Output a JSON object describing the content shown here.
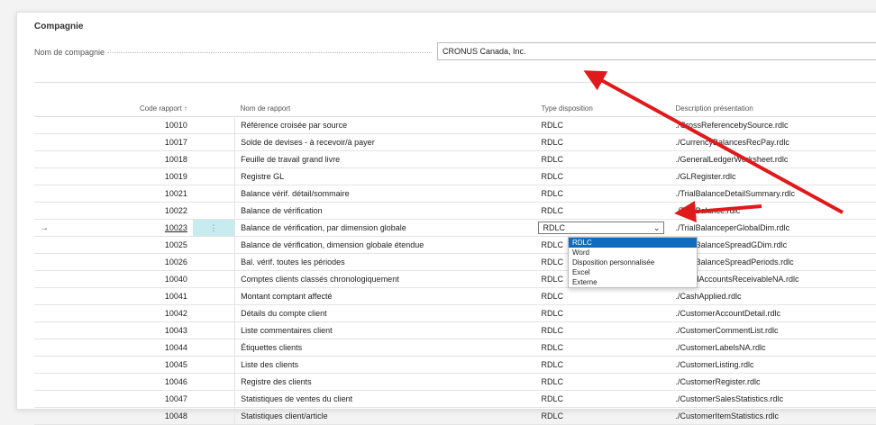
{
  "section": {
    "title": "Compagnie"
  },
  "company": {
    "label": "Nom de compagnie",
    "value": "CRONUS Canada, Inc."
  },
  "table": {
    "headers": {
      "code": "Code rapport ↑",
      "name": "Nom de rapport",
      "type": "Type disposition",
      "description": "Description présentation"
    },
    "rows": [
      {
        "code": "10010",
        "name": "Référence croisée par source",
        "type": "RDLC",
        "description": "./CrossReferencebySource.rdlc"
      },
      {
        "code": "10017",
        "name": "Solde de devises - à recevoir/à payer",
        "type": "RDLC",
        "description": "./CurrencyBalancesRecPay.rdlc"
      },
      {
        "code": "10018",
        "name": "Feuille de travail grand livre",
        "type": "RDLC",
        "description": "./GeneralLedgerWorksheet.rdlc"
      },
      {
        "code": "10019",
        "name": "Registre GL",
        "type": "RDLC",
        "description": "./GLRegister.rdlc"
      },
      {
        "code": "10021",
        "name": "Balance vérif. détail/sommaire",
        "type": "RDLC",
        "description": "./TrialBalanceDetailSummary.rdlc"
      },
      {
        "code": "10022",
        "name": "Balance de vérification",
        "type": "RDLC",
        "description": "./TrialBalance.rdlc"
      },
      {
        "code": "10023",
        "name": "Balance de vérification, par dimension globale",
        "type": "RDLC",
        "description": "./TrialBalanceperGlobalDim.rdlc"
      },
      {
        "code": "10025",
        "name": "Balance de vérification, dimension globale étendue",
        "type": "RDLC",
        "description": "./TrialBalanceSpreadGDim.rdlc"
      },
      {
        "code": "10026",
        "name": "Bal. vérif. toutes les périodes",
        "type": "RDLC",
        "description": "./TrialBalanceSpreadPeriods.rdlc"
      },
      {
        "code": "10040",
        "name": "Comptes clients classés chronologiquement",
        "type": "RDLC",
        "description": "./AgedAccountsReceivableNA.rdlc"
      },
      {
        "code": "10041",
        "name": "Montant comptant affecté",
        "type": "RDLC",
        "description": "./CashApplied.rdlc"
      },
      {
        "code": "10042",
        "name": "Détails du compte client",
        "type": "RDLC",
        "description": "./CustomerAccountDetail.rdlc"
      },
      {
        "code": "10043",
        "name": "Liste commentaires client",
        "type": "RDLC",
        "description": "./CustomerCommentList.rdlc"
      },
      {
        "code": "10044",
        "name": "Étiquettes clients",
        "type": "RDLC",
        "description": "./CustomerLabelsNA.rdlc"
      },
      {
        "code": "10045",
        "name": "Liste des clients",
        "type": "RDLC",
        "description": "./CustomerListing.rdlc"
      },
      {
        "code": "10046",
        "name": "Registre des clients",
        "type": "RDLC",
        "description": "./CustomerRegister.rdlc"
      },
      {
        "code": "10047",
        "name": "Statistiques de ventes du client",
        "type": "RDLC",
        "description": "./CustomerSalesStatistics.rdlc"
      },
      {
        "code": "10048",
        "name": "Statistiques client/article",
        "type": "RDLC",
        "description": "./CustomerItemStatistics.rdlc"
      }
    ]
  },
  "selected_row": {
    "index": 6,
    "marker_icon": "arrow-right-icon",
    "marker": "→",
    "menu": "⋮"
  },
  "dropdown": {
    "current": "RDLC",
    "options": [
      "RDLC",
      "Word",
      "Disposition personnalisée",
      "Excel",
      "Externe"
    ]
  },
  "colors": {
    "arrow": "#e0191b",
    "highlight": "#c7ecef",
    "selected_option": "#0f6cbd"
  }
}
